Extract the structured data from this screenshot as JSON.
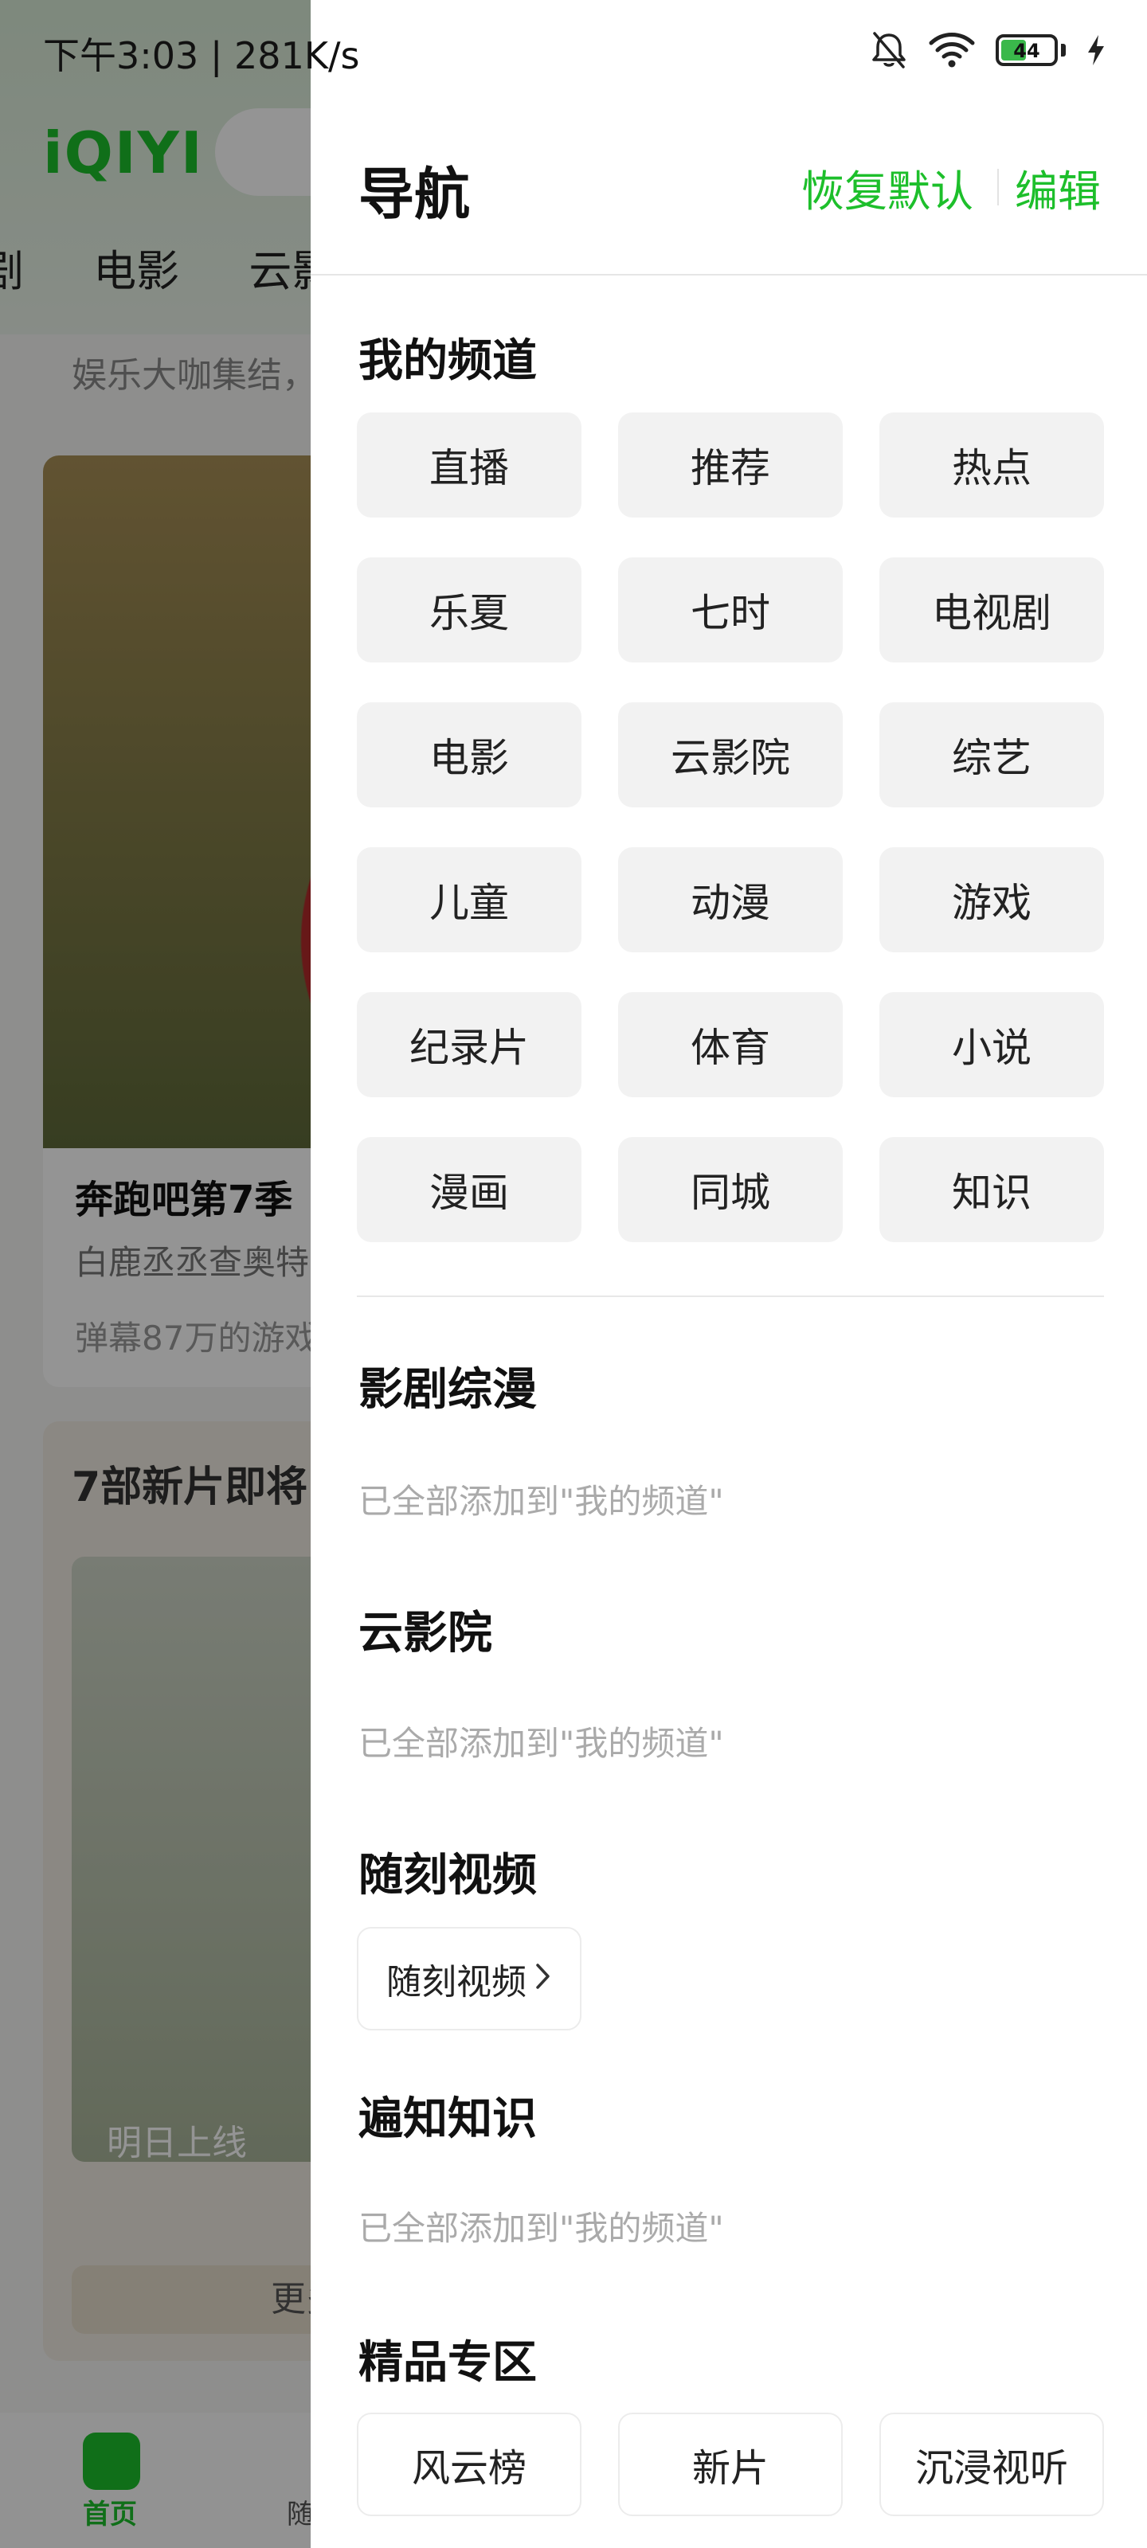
{
  "status_bar": {
    "time_speed": "下午3:03 | 281K/s",
    "battery_level": "44",
    "icons": [
      "bell-muted-icon",
      "wifi-icon",
      "battery-icon",
      "charging-icon"
    ]
  },
  "background_app": {
    "logo": "iQIYI",
    "tabs": [
      "剧",
      "电影",
      "云影"
    ],
    "prev_card_text": "娱乐大咖集结，",
    "card_title": "奔跑吧第7季",
    "card_subtitle": "白鹿丞丞查奥特",
    "card_meta": "弹幕87万的游戏",
    "card2_title": "7部新片即将",
    "card2_tag": "明日上线",
    "card2_more": "更多新",
    "nav_home": "首页",
    "nav_second": "随"
  },
  "drawer": {
    "title": "导航",
    "restore_label": "恢复默认",
    "edit_label": "编辑",
    "my_channels": {
      "title": "我的频道",
      "items": [
        "直播",
        "推荐",
        "热点",
        "乐夏",
        "七时",
        "电视剧",
        "电影",
        "云影院",
        "综艺",
        "儿童",
        "动漫",
        "游戏",
        "纪录片",
        "体育",
        "小说",
        "漫画",
        "同城",
        "知识"
      ]
    },
    "sections": [
      {
        "title": "影剧综漫",
        "note": "已全部添加到\"我的频道\""
      },
      {
        "title": "云影院",
        "note": "已全部添加到\"我的频道\""
      },
      {
        "title": "随刻视频",
        "link_label": "随刻视频"
      },
      {
        "title": "遍知知识",
        "note": "已全部添加到\"我的频道\""
      },
      {
        "title": "精品专区",
        "items": [
          "风云榜",
          "新片",
          "沉浸视听"
        ]
      }
    ]
  },
  "colors": {
    "accent": "#1dbf2b",
    "chip_bg": "#f2f2f2",
    "note_text": "#aaaaaa"
  }
}
